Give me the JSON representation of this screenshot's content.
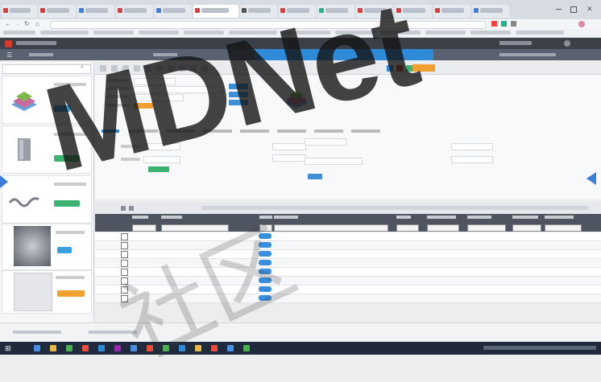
{
  "colors": {
    "accent": "#2f8ad8",
    "orange": "#f0a030",
    "green": "#3cb371",
    "header": "#3c4048",
    "grid_header": "#4e5460"
  },
  "watermark": {
    "text": "MDNet",
    "subtext": "社区"
  },
  "sidebar": {
    "items": [
      {
        "pill_color": "#3aa0e0",
        "thumb": "layers-icon"
      },
      {
        "pill_color": "#3cb371",
        "thumb": "cabinet-icon"
      },
      {
        "pill_color": "#3cb371",
        "thumb": "chain-icon"
      },
      {
        "pill_color": "#3aa0e0",
        "thumb": "swirl-icon"
      },
      {
        "pill_color": "#f0a030",
        "thumb": "drawing-icon"
      }
    ]
  },
  "grid": {
    "rows": 8
  }
}
